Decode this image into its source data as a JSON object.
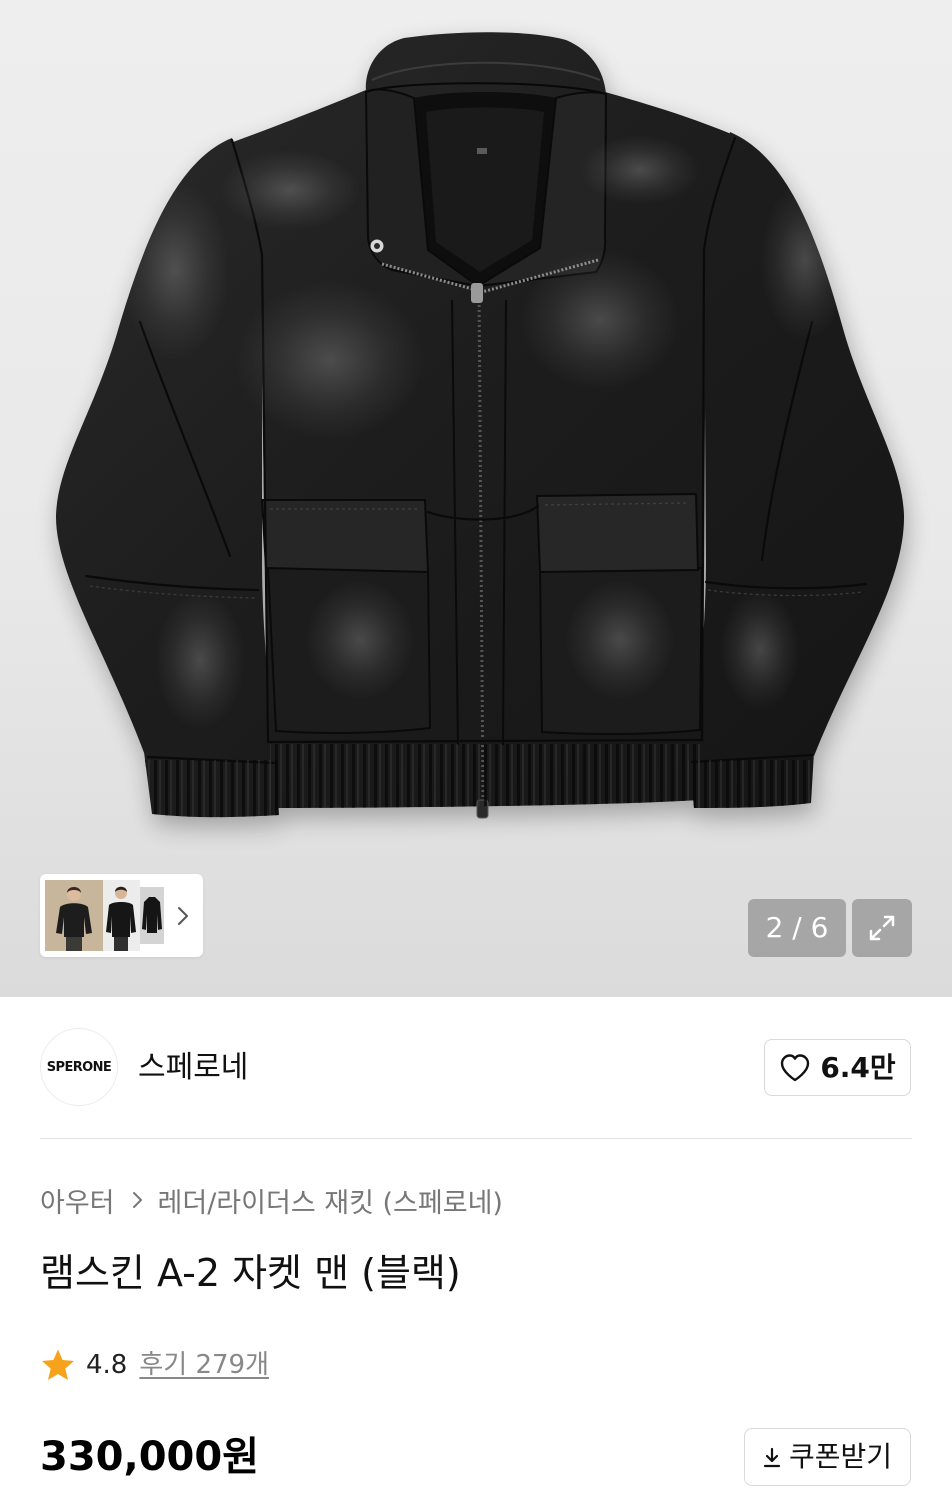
{
  "gallery": {
    "counter": "2 / 6",
    "expand_icon": "expand-icon",
    "thumbnail_next_icon": "chevron-right-icon"
  },
  "brand": {
    "logo_text": "SPERONE",
    "name": "스페로네"
  },
  "like_button": {
    "icon": "heart-icon",
    "count": "6.4만"
  },
  "breadcrumb": {
    "items": [
      "아우터",
      "레더/라이더스 재킷 (스페로네)"
    ],
    "separator_icon": "chevron-right-icon"
  },
  "product": {
    "title": "램스킨 A-2 자켓 맨 (블랙)",
    "rating": {
      "icon": "star-icon",
      "value": "4.8",
      "reviews": "후기 279개"
    },
    "price": "330,000원"
  },
  "coupon_button": {
    "icon": "download-icon",
    "label": "쿠폰받기"
  },
  "colors": {
    "star": "#f6a31b",
    "breadcrumb": "#777777",
    "review_link": "#888888",
    "text": "#111111"
  }
}
